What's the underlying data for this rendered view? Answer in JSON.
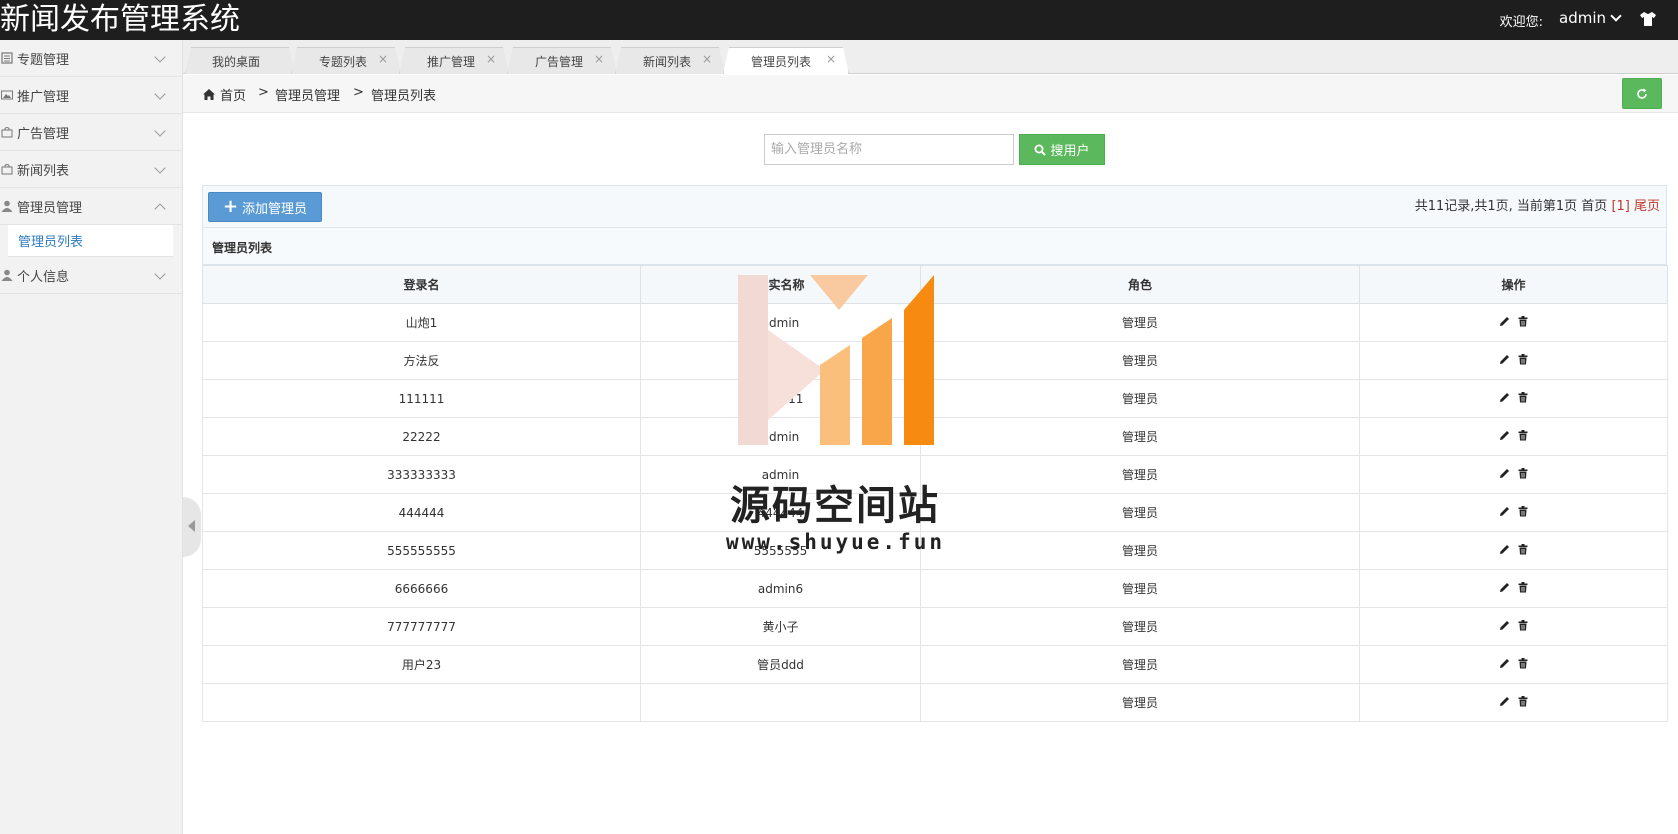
{
  "header": {
    "app_title": "新闻发布管理系统",
    "welcome_label": "欢迎您:",
    "username": "admin",
    "user_menu_icon": "chevron-down-icon",
    "skin_icon": "tshirt-icon"
  },
  "sidebar": {
    "items": [
      {
        "label": "专题管理",
        "icon": "list-icon"
      },
      {
        "label": "推广管理",
        "icon": "image-icon"
      },
      {
        "label": "广告管理",
        "icon": "bag-icon"
      },
      {
        "label": "新闻列表",
        "icon": "bag-icon"
      },
      {
        "label": "管理员管理",
        "icon": "user-icon",
        "expanded": true
      },
      {
        "label": "个人信息",
        "icon": "user-icon"
      }
    ],
    "sub_items": [
      {
        "label": "管理员列表",
        "active": true
      }
    ]
  },
  "tabs": [
    {
      "label": "我的桌面",
      "closable": false
    },
    {
      "label": "专题列表",
      "closable": true
    },
    {
      "label": "推广管理",
      "closable": true
    },
    {
      "label": "广告管理",
      "closable": true
    },
    {
      "label": "新闻列表",
      "closable": true
    },
    {
      "label": "管理员列表",
      "closable": true,
      "active": true
    }
  ],
  "tab_close_glyph": "×",
  "breadcrumb": {
    "home": "首页",
    "separator": ">",
    "level1": "管理员管理",
    "level2": "管理员列表"
  },
  "search": {
    "placeholder": "输入管理员名称",
    "value": "",
    "button_label": "搜用户"
  },
  "toolbar": {
    "add_label": "添加管理员",
    "pager_text": "共11记录,共1页, 当前第1页 首页 ",
    "pager_current": "[1]",
    "pager_last": " 尾页"
  },
  "panel": {
    "title": "管理员列表"
  },
  "table": {
    "columns": [
      "登录名",
      "真实名称",
      "角色",
      "操作"
    ],
    "rows": [
      {
        "login": "山炮1",
        "real": "admin",
        "role": "管理员"
      },
      {
        "login": "方法反",
        "real": "admin",
        "role": "管理员"
      },
      {
        "login": "111111",
        "real": "111111",
        "role": "管理员"
      },
      {
        "login": "22222",
        "real": "admin",
        "role": "管理员"
      },
      {
        "login": "333333333",
        "real": "admin",
        "role": "管理员"
      },
      {
        "login": "444444",
        "real": "444444",
        "role": "管理员"
      },
      {
        "login": "555555555",
        "real": "5555555",
        "role": "管理员"
      },
      {
        "login": "6666666",
        "real": "admin6",
        "role": "管理员"
      },
      {
        "login": "777777777",
        "real": "黄小子",
        "role": "管理员"
      },
      {
        "login": "用户23",
        "real": "管员ddd",
        "role": "管理员"
      },
      {
        "login": "",
        "real": "",
        "role": "管理员"
      }
    ],
    "action_icons": [
      "pencil-icon",
      "trash-icon"
    ]
  },
  "watermark": {
    "title": "源码空间站",
    "url": "www.shuyue.fun"
  },
  "colors": {
    "header_bg": "#1e1e1e",
    "success": "#5cb85c",
    "primary": "#5b9bd5",
    "link": "#2d7cbf",
    "pager_red": "#c0392b"
  }
}
